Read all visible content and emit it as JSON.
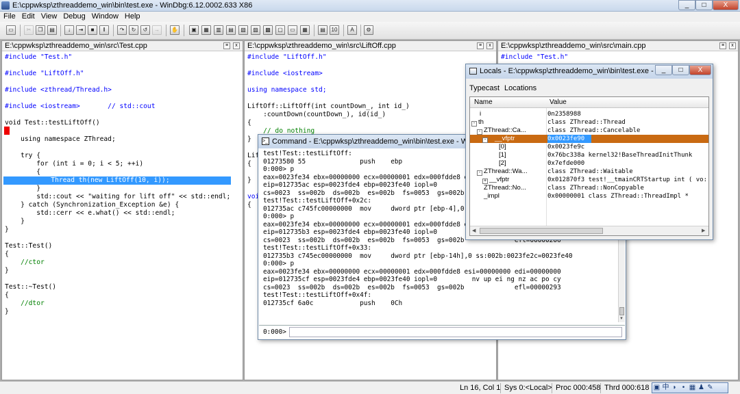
{
  "window": {
    "title": "E:\\cppwksp\\zthreaddemo_win\\bin\\test.exe - WinDbg:6.12.0002.633 X86",
    "controls": [
      "_",
      "□",
      "X"
    ]
  },
  "menu": [
    "File",
    "Edit",
    "View",
    "Debug",
    "Window",
    "Help"
  ],
  "panes": {
    "test": {
      "title": "E:\\cppwksp\\zthreaddemo_win\\src\\Test.cpp",
      "lines": [
        "#include \"Test.h\"",
        "",
        "#include \"LiftOff.h\"",
        "",
        "#include <zthread/Thread.h>",
        "",
        "#include <iostream>       // std::cout",
        "",
        "void Test::testLiftOff()",
        "{",
        "    using namespace ZThread;",
        "",
        "    try {",
        "        for (int i = 0; i < 5; ++i)",
        "        {",
        "            Thread th(new LiftOff(10, i));",
        "        }",
        "        std::cout << \"waiting for lift off\" << std::endl;",
        "    } catch (Synchronization_Exception &e) {",
        "        std::cerr << e.what() << std::endl;",
        "    }",
        "}",
        "",
        "Test::Test()",
        "{",
        "    //ctor",
        "}",
        "",
        "Test::~Test()",
        "{",
        "    //dtor",
        "}"
      ]
    },
    "liftoff": {
      "title": "E:\\cppwksp\\zthreaddemo_win\\src\\LiftOff.cpp",
      "lines": [
        "#include \"LiftOff.h\"",
        "",
        "#include <iostream>",
        "",
        "using namespace std;",
        "",
        "LiftOff::LiftOff(int countDown_, int id_)",
        "    :countDown(countDown_), id(id_)",
        "{",
        "    // do nothing",
        "}",
        "",
        "Lif",
        "{",
        "",
        "}",
        "",
        "voi",
        "{"
      ]
    },
    "main": {
      "title": "E:\\cppwksp\\zthreaddemo_win\\src\\main.cpp",
      "lines": [
        "#include \"Test.h\""
      ]
    }
  },
  "command": {
    "title": "Command - E:\\cppwksp\\zthreaddemo_win\\bin\\test.exe - Win",
    "lines": [
      "test!Test::testLiftOff:",
      "01273580 55              push    ebp",
      "0:000> p",
      "eax=0023fe34 ebx=00000000 ecx=00000001 edx=000fdde8 e",
      "eip=012735ac esp=0023fde4 ebp=0023fe40 iopl=0",
      "cs=0023  ss=002b  ds=002b  es=002b  fs=0053  gs=002b",
      "test!Test::testLiftOff+0x2c:",
      "012735ac c745fc00000000  mov     dword ptr [ebp-4],0",
      "0:000> p",
      "eax=0023fe34 ebx=00000000 ecx=00000001 edx=000fdde8 e",
      "eip=012735b3 esp=0023fde4 ebp=0023fe40 iopl=0",
      "cs=0023  ss=002b  ds=002b  es=002b  fs=0053  gs=002b             efl=00000206",
      "test!Test::testLiftOff+0x33:",
      "012735b3 c745ec00000000  mov     dword ptr [ebp-14h],0 ss:002b:0023fe2c=0023fe40",
      "0:000> p",
      "eax=0023fe34 ebx=00000000 ecx=00000001 edx=000fdde8 esi=00000000 edi=00000000",
      "eip=012735cf esp=0023fde4 ebp=0023fe40 iopl=0         nv up ei ng nz ac po cy",
      "cs=0023  ss=002b  ds=002b  es=002b  fs=0053  gs=002b             efl=00000293",
      "test!Test::testLiftOff+0x4f:",
      "012735cf 6a0c            push    0Ch"
    ],
    "prompt": "0:000>"
  },
  "locals": {
    "title": "Locals - E:\\cppwksp\\zthreaddemo_win\\bin\\test.exe - ...",
    "menu": [
      "Typecast",
      "Locations"
    ],
    "headers": {
      "name": "Name",
      "value": "Value"
    },
    "rows": [
      {
        "name": "i",
        "value": "0n2358988",
        "indent": 12,
        "box": ""
      },
      {
        "name": "th",
        "value": "class ZThread::Thread",
        "indent": 2,
        "box": "-"
      },
      {
        "name": "ZThread::Ca...",
        "value": "class ZThread::Cancelable",
        "indent": 10,
        "box": "-"
      },
      {
        "name": "__vfptr",
        "value": "0x0023fe90",
        "indent": 18,
        "box": "-"
      },
      {
        "name": "[0]",
        "value": "0x0023fe9c",
        "indent": 40,
        "box": ""
      },
      {
        "name": "[1]",
        "value": "0x76bc338a kernel32!BaseThreadInitThunk",
        "indent": 40,
        "box": ""
      },
      {
        "name": "[2]",
        "value": "0x7efde000",
        "indent": 40,
        "box": ""
      },
      {
        "name": "ZThread::Wa...",
        "value": "class ZThread::Waitable",
        "indent": 10,
        "box": "-"
      },
      {
        "name": "__vfptr",
        "value": "0x012870f3 test!__tmainCRTStartup int ( vo:",
        "indent": 18,
        "box": "+"
      },
      {
        "name": "ZThread::No...",
        "value": "class ZThread::NonCopyable",
        "indent": 18,
        "box": ""
      },
      {
        "name": "_impl",
        "value": "0x00000001 class ZThread::ThreadImpl *",
        "indent": 18,
        "box": ""
      }
    ]
  },
  "status": {
    "ln_col": "Ln 16, Col 1",
    "sys": "Sys 0:<Local>",
    "proc": "Proc 000:458",
    "thrd": "Thrd 000:618",
    "ime": [
      "中",
      "◗",
      "•",
      "⁰",
      "▦",
      "♟",
      "✎"
    ]
  }
}
